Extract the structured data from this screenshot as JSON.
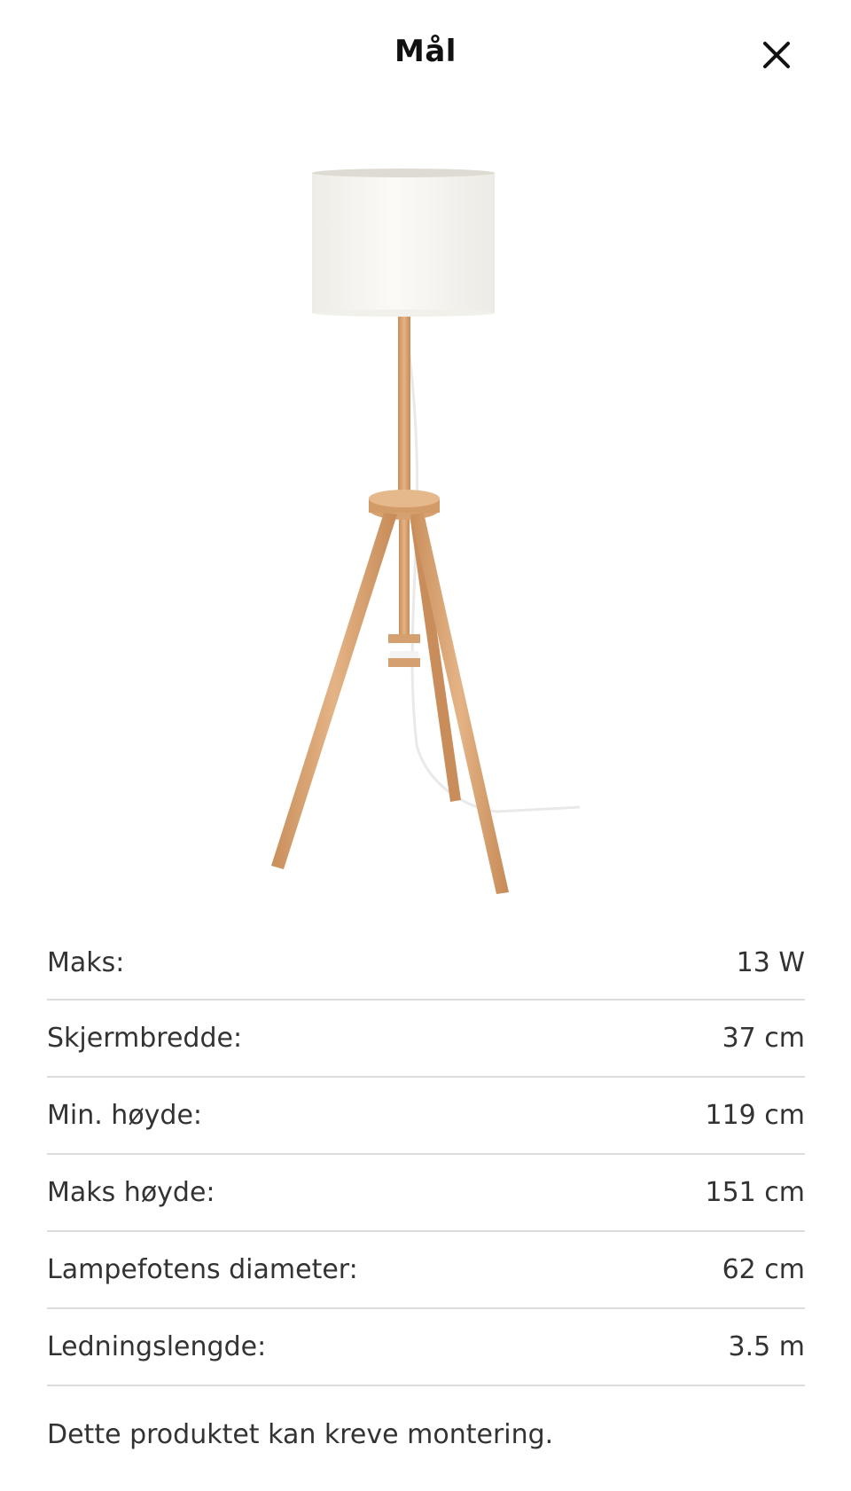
{
  "header": {
    "title": "Mål",
    "close_icon": "close-icon"
  },
  "product_image": {
    "icon": "floor-lamp-tripod",
    "colors": {
      "shade": "#f7f6f1",
      "wood": "#d9a06c"
    }
  },
  "specs": [
    {
      "label": "Maks:",
      "value": "13 W"
    },
    {
      "label": "Skjermbredde:",
      "value": "37 cm"
    },
    {
      "label": "Min. høyde:",
      "value": "119 cm"
    },
    {
      "label": "Maks høyde:",
      "value": "151 cm"
    },
    {
      "label": "Lampefotens diameter:",
      "value": "62 cm"
    },
    {
      "label": "Ledningslengde:",
      "value": "3.5 m"
    }
  ],
  "note": "Dette produktet kan kreve montering."
}
